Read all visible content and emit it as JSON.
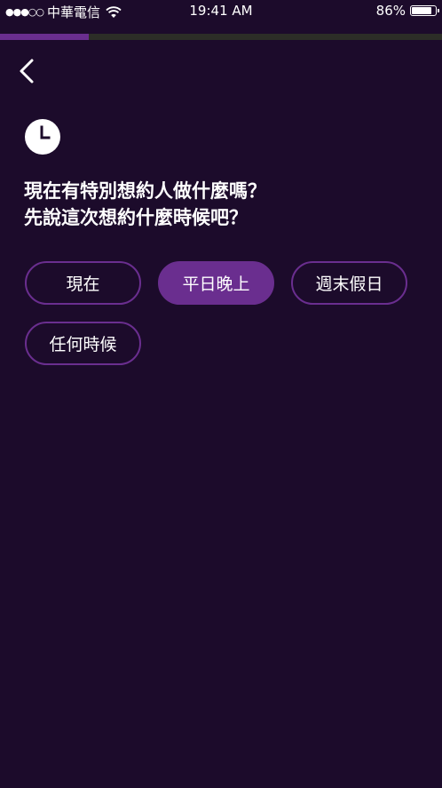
{
  "status_bar": {
    "signal": "●●●○○",
    "carrier": "中華電信",
    "time": "19:41 AM",
    "battery_percent": "86%",
    "battery_level": 0.86
  },
  "progress": {
    "fraction": 0.2,
    "fill_color": "#6a2e8f",
    "track_color": "#2c2d27"
  },
  "icons": {
    "back": "chevron-left-icon",
    "clock": "clock-icon"
  },
  "question": {
    "line1": "現在有特別想約人做什麼嗎？",
    "line2": "先說這次想約什麼時候吧？"
  },
  "options": [
    {
      "label": "現在",
      "selected": false
    },
    {
      "label": "平日晚上",
      "selected": true
    },
    {
      "label": "週末假日",
      "selected": false
    },
    {
      "label": "任何時候",
      "selected": false
    }
  ],
  "colors": {
    "background": "#1c0b2b",
    "accent": "#6a2e8f",
    "text": "#ffffff"
  }
}
